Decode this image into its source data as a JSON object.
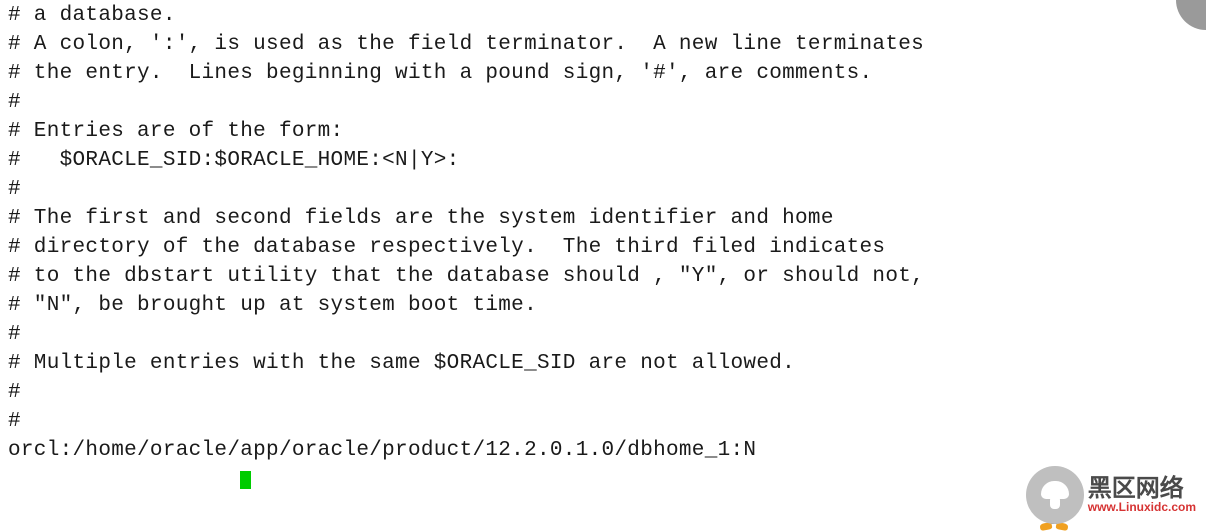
{
  "lines": [
    "# a database.",
    "",
    "# A colon, ':', is used as the field terminator.  A new line terminates",
    "# the entry.  Lines beginning with a pound sign, '#', are comments.",
    "#",
    "# Entries are of the form:",
    "#   $ORACLE_SID:$ORACLE_HOME:<N|Y>:",
    "#",
    "# The first and second fields are the system identifier and home",
    "# directory of the database respectively.  The third filed indicates",
    "# to the dbstart utility that the database should , \"Y\", or should not,",
    "# \"N\", be brought up at system boot time.",
    "#",
    "# Multiple entries with the same $ORACLE_SID are not allowed.",
    "#",
    "#",
    "orcl:/home/oracle/app/oracle/product/12.2.0.1.0/dbhome_1:N"
  ],
  "watermark": {
    "cn_text": "黑区网络",
    "url": "www.Linuxidc.com"
  }
}
